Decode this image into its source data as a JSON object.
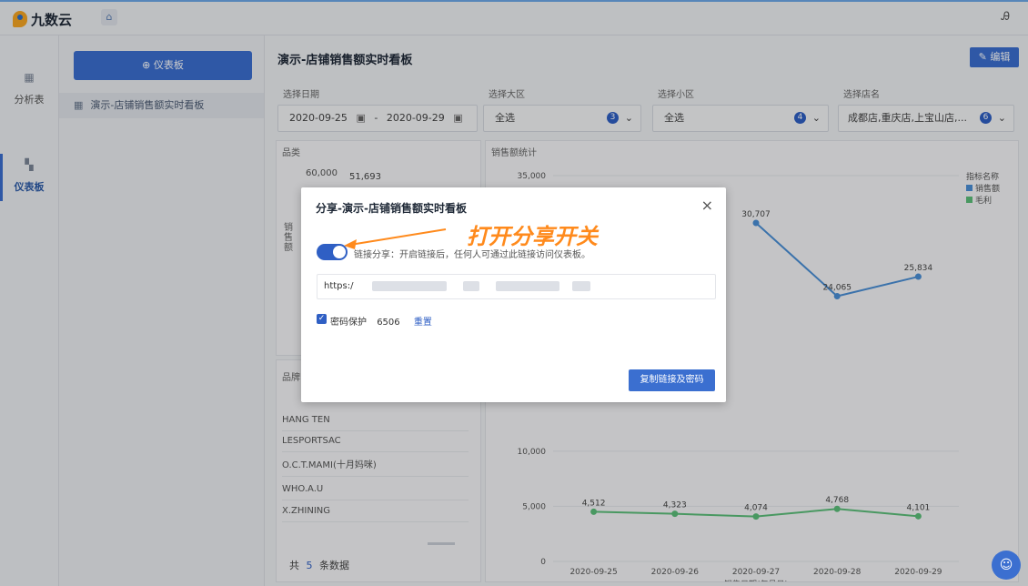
{
  "app": {
    "logo_text": "九数云",
    "home_icon": "home-icon",
    "user_icon": "user-icon"
  },
  "rail": {
    "items": [
      {
        "label": "分析表",
        "icon": "analysis-icon"
      },
      {
        "label": "仪表板",
        "icon": "dashboard-icon",
        "active": true
      }
    ]
  },
  "sidebar": {
    "new_button": "⊕ 仪表板",
    "item": "演示-店铺销售额实时看板"
  },
  "dashboard": {
    "title": "演示-店铺销售额实时看板",
    "edit": "编辑",
    "filters": {
      "date_label": "选择日期",
      "date_from": "2020-09-25",
      "date_sep": "-",
      "date_to": "2020-09-29",
      "region_label": "选择大区",
      "region_value": "全选",
      "region_count": "3",
      "subregion_label": "选择小区",
      "subregion_value": "全选",
      "subregion_count": "4",
      "store_label": "选择店名",
      "store_value": "成都店,重庆店,上宝山店,...",
      "store_count": "6"
    },
    "category_card": {
      "title": "品类",
      "ytick_top": "60,000",
      "value_label": "51,693",
      "axis_label_chars": [
        "销",
        "售",
        "额"
      ]
    },
    "brand_card": {
      "title": "品牌",
      "rows": [
        "HANG TEN",
        "LESPORTSAC",
        "O.C.T.MAMI(十月妈咪)",
        "WHO.A.U",
        "X.ZHINING"
      ],
      "footer_prefix": "共",
      "footer_count": "5",
      "footer_suffix": "条数据"
    },
    "sales_card": {
      "title": "销售额统计",
      "legend_title": "指标名称",
      "legend": [
        "销售额",
        "毛利"
      ]
    }
  },
  "modal": {
    "title": "分享-演示-店铺销售额实时看板",
    "share_text": "链接分享：开启链接后，任何人可通过此链接访问仪表板。",
    "share_enabled": true,
    "url_prefix": "https:/",
    "password_label": "密码保护",
    "password": "6506",
    "reset": "重置",
    "copy_button": "复制链接及密码"
  },
  "annotation": {
    "text": "打开分享开关"
  },
  "colors": {
    "accent": "#3b6fd0",
    "series_sales": "#4a8fd6",
    "series_profit": "#5cbf7a",
    "callout": "#ff8a1c"
  },
  "chart_data": {
    "type": "line",
    "title": "销售额统计",
    "xlabel": "销售日期(年月日)",
    "ylabel": "",
    "x": [
      "2020-09-25",
      "2020-09-26",
      "2020-09-27",
      "2020-09-28",
      "2020-09-29"
    ],
    "yticks": [
      "0",
      "5,000",
      "10,000",
      "35,000"
    ],
    "ylim": [
      0,
      35000
    ],
    "series": [
      {
        "name": "销售额",
        "values": [
          null,
          null,
          30707,
          24065,
          25834
        ],
        "labels": [
          "",
          "",
          "30,707",
          "24,065",
          "25,834"
        ]
      },
      {
        "name": "毛利",
        "values": [
          4512,
          4323,
          4074,
          4768,
          4101
        ],
        "labels": [
          "4,512",
          "4,323",
          "4,074",
          "4,768",
          "4,101"
        ]
      }
    ],
    "legend_position": "right"
  }
}
